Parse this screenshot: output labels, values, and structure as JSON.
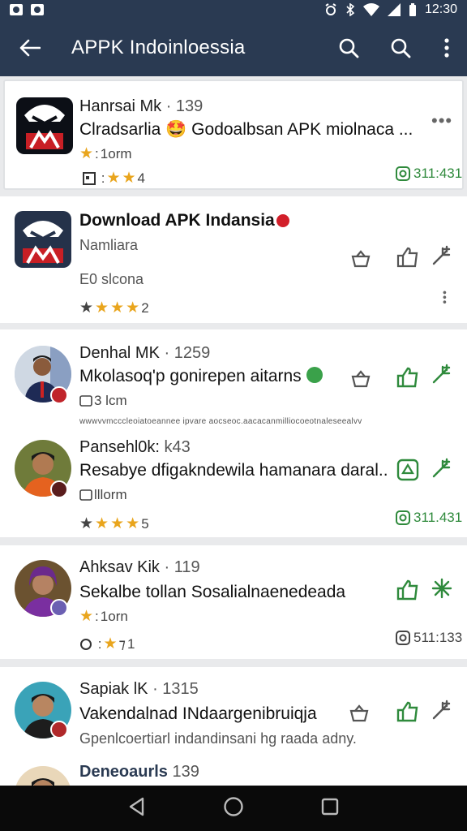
{
  "status_bar": {
    "time": "12:30"
  },
  "app_bar": {
    "title": "APPK Indoinloessia"
  },
  "posts": [
    {
      "name": "Hanrsai Mk",
      "meta": "· 139",
      "text": "Clradsarlia 🤩 Godoalbsan APK miolnaca ...",
      "sub": "1orm",
      "rating": "4",
      "count": "311:431"
    },
    {
      "title": "Download APK Indansia",
      "subtitle": "Namliara",
      "sub": "E0 slcona",
      "rating": "2"
    },
    {
      "name": "Denhal MK",
      "meta": "· 1259",
      "text": "Mkolasoq'p gonirepen aitarns",
      "sub": "3 lcm",
      "tiny": "wwwvvmcccleoiatoeannee  ipvare  aocseoc.aacacanmilliocoeotnaleseealvv"
    },
    {
      "name": "Pansehl0k:",
      "meta": "k43",
      "text": "Resabye dfigakndewila hamanara daral..",
      "sub": "lllorm",
      "rating": "5",
      "count": "311.431"
    },
    {
      "name": "Ahksav Kik",
      "meta": "· 119",
      "text": "Sekalbe tollan Sosalialnaenedeada",
      "sub": "1orn",
      "rating": "1",
      "count": "511:133"
    },
    {
      "name": "Sapiak lK",
      "meta": "· 1315",
      "text": "Vakendalnad INdaargenibruiqja",
      "sub": "Gpenlcoertiarl indandinsani hg raada adny."
    },
    {
      "name": "Deneoaurls",
      "meta": "139"
    }
  ]
}
